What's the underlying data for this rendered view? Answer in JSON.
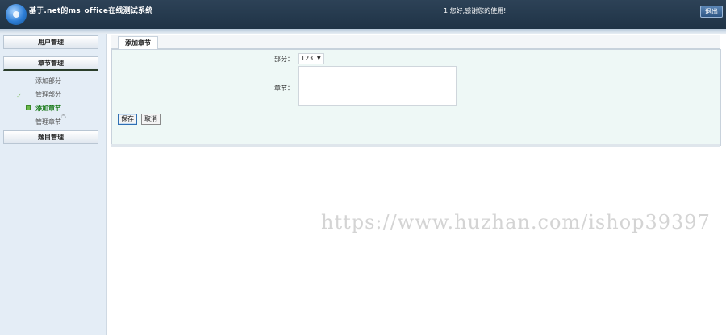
{
  "header": {
    "title": "基于.net的ms_office在线测试系统",
    "greeting": "1 您好,感谢您的使用!",
    "exit_label": "退出"
  },
  "sidebar": {
    "menus": [
      {
        "label": "用户管理"
      },
      {
        "label": "章节管理"
      },
      {
        "label": "题目管理"
      }
    ],
    "chapter_items": [
      {
        "label": "添加部分"
      },
      {
        "label": "管理部分"
      },
      {
        "label": "添加章节"
      },
      {
        "label": "管理章节"
      }
    ]
  },
  "main": {
    "tab_label": "添加章节",
    "part_label": "部分：",
    "part_value": "123",
    "chapter_label": "章节：",
    "chapter_value": "",
    "save_label": "保存",
    "cancel_label": "取消"
  },
  "watermark": "https://www.huzhan.com/ishop39397",
  "colors": {
    "header_bg": "#2d4257",
    "sidebar_bg": "#e4edf6",
    "panel_bg": "#eef8f6",
    "active_item": "#1a7a1a"
  }
}
